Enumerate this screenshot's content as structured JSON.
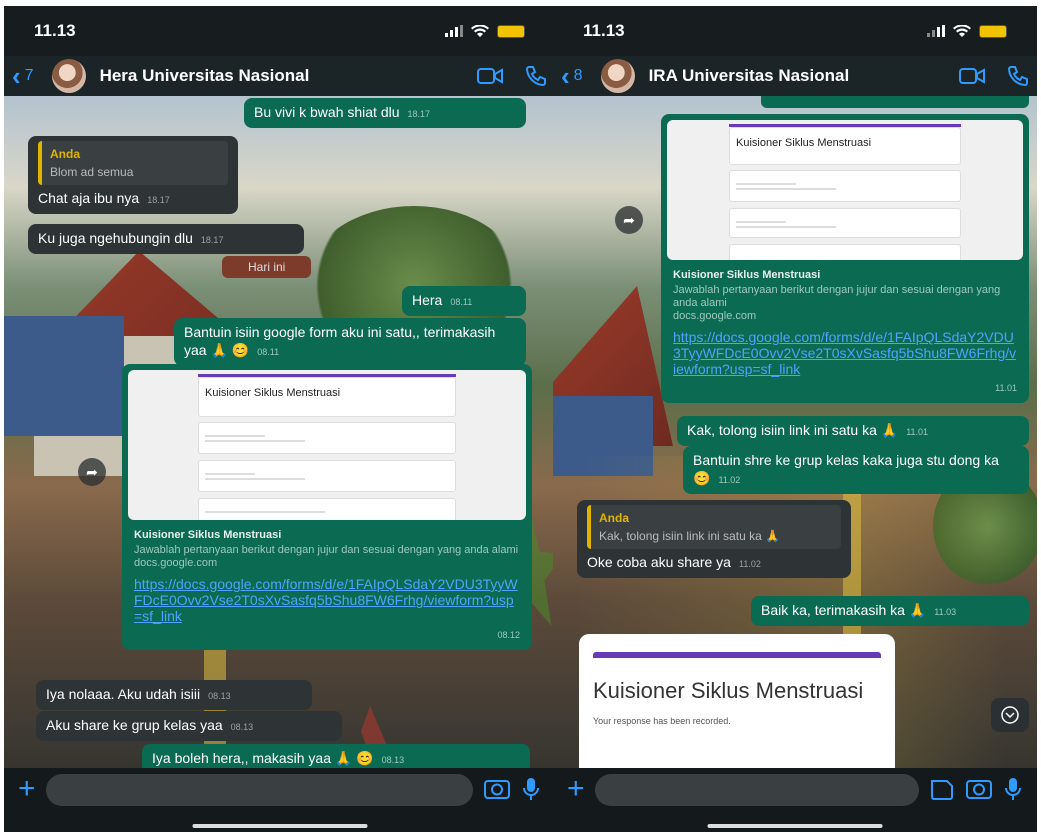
{
  "left": {
    "status_time": "11.13",
    "back_count": "7",
    "contact_name": "Hera Universitas Nasional",
    "messages": {
      "m1": {
        "text": "Bu vivi k bwah shiat dlu",
        "time": "18.17"
      },
      "m2": {
        "quote_author": "Anda",
        "quote_text": "Blom ad semua",
        "text": "Chat aja ibu nya",
        "time": "18.17"
      },
      "m3": {
        "text": "Ku juga ngehubungin dlu",
        "time": "18.17"
      },
      "day": "Hari ini",
      "m4": {
        "text": "Hera",
        "time": "08.11"
      },
      "m5": {
        "text": "Bantuin isiin google form aku ini satu,, terimakasih yaa 🙏 😊",
        "time": "08.11"
      },
      "m6": {
        "form_title": "Kuisioner Siklus Menstruasi",
        "link_title": "Kuisioner Siklus Menstruasi",
        "link_desc": "Jawablah pertanyaan berikut dengan jujur dan sesuai dengan yang anda alami",
        "link_domain": "docs.google.com",
        "url": "https://docs.google.com/forms/d/e/1FAIpQLSdaY2VDU3TyyWFDcE0Ovv2Vse2T0sXvSasfq5bShu8FW6Frhg/viewform?usp=sf_link",
        "time": "08.12"
      },
      "m7": {
        "text": "Iya nolaaa. Aku udah isiii",
        "time": "08.13"
      },
      "m8": {
        "text": "Aku share ke grup kelas yaa",
        "time": "08.13"
      },
      "m9": {
        "text": "Iya boleh hera,, makasih yaa 🙏 😊",
        "time": "08.13"
      }
    }
  },
  "right": {
    "status_time": "11.13",
    "back_count": "8",
    "contact_name": "IRA Universitas Nasional",
    "messages": {
      "m1": {
        "form_title": "Kuisioner Siklus Menstruasi",
        "link_title": "Kuisioner Siklus Menstruasi",
        "link_desc": "Jawablah pertanyaan berikut dengan jujur dan sesuai dengan yang anda alami",
        "link_domain": "docs.google.com",
        "url": "https://docs.google.com/forms/d/e/1FAIpQLSdaY2VDU3TyyWFDcE0Ovv2Vse2T0sXvSasfq5bShu8FW6Frhg/viewform?usp=sf_link",
        "time": "11.01"
      },
      "m2": {
        "text": "Kak, tolong isiin link ini satu ka 🙏",
        "time": "11.01"
      },
      "m3": {
        "text": "Bantuin shre ke grup kelas kaka juga stu dong ka 😊",
        "time": "11.02"
      },
      "m4": {
        "quote_author": "Anda",
        "quote_text": "Kak, tolong isiin link ini satu ka 🙏",
        "text": "Oke coba aku share ya",
        "time": "11.02"
      },
      "m5": {
        "text": "Baik ka, terimakasih ka 🙏",
        "time": "11.03"
      },
      "m6": {
        "title": "Kuisioner Siklus Menstruasi",
        "subtitle": "Your response has been recorded."
      }
    }
  },
  "colors": {
    "outgoing": "#0b6a52",
    "incoming": "#2e3336",
    "accent": "#2f9bff",
    "quote": "#e0b400"
  },
  "icons": [
    "signal-icon",
    "wifi-icon",
    "battery-icon",
    "video-call-icon",
    "phone-icon",
    "forward-icon",
    "camera-icon",
    "mic-icon",
    "sticker-icon",
    "chevron-down-icon",
    "plus-icon"
  ]
}
